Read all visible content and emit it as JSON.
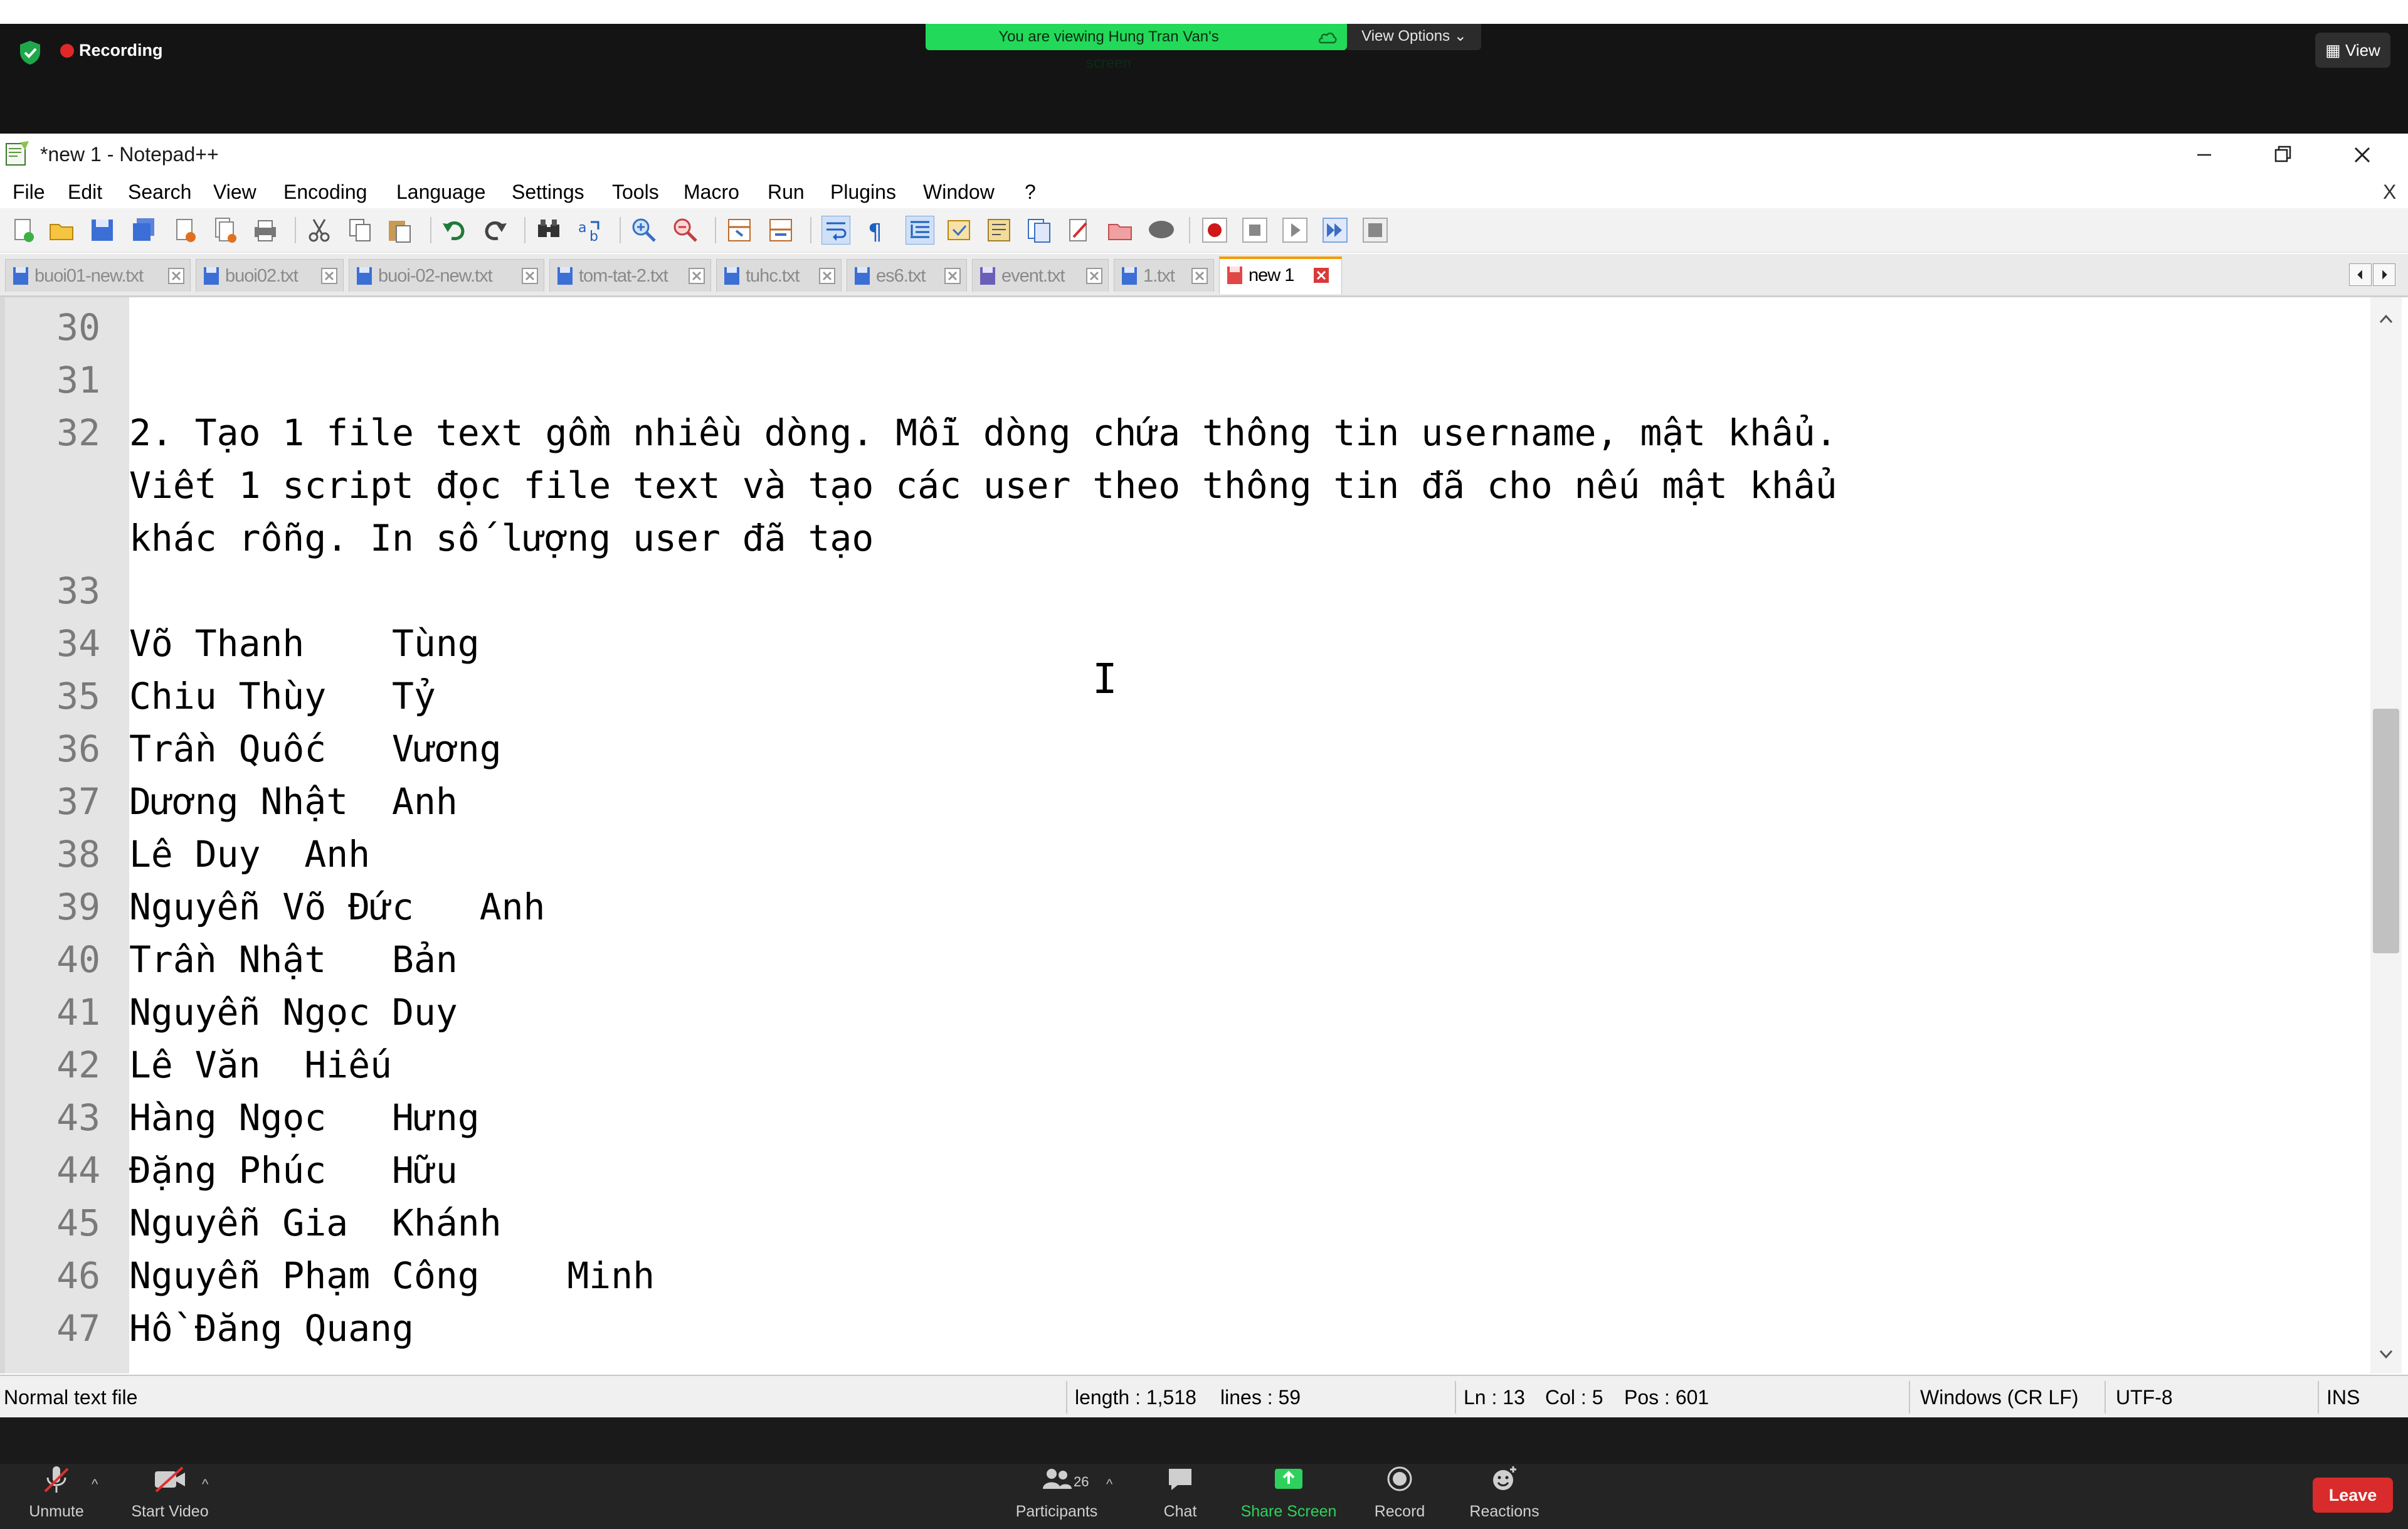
{
  "zoom": {
    "recording_label": "Recording",
    "viewing_banner": "You are viewing Hung Tran Van's screen",
    "view_options_label": "View Options ⌄",
    "view_button_label": "View",
    "bottom": {
      "unmute": "Unmute",
      "start_video": "Start Video",
      "participants": "Participants",
      "participants_count": "26",
      "chat": "Chat",
      "share_screen": "Share Screen",
      "record": "Record",
      "reactions": "Reactions",
      "leave": "Leave"
    },
    "colors": {
      "share_green": "#2ed15c",
      "leave_red": "#d92b2b",
      "banner_green": "#23d959"
    }
  },
  "notepad": {
    "title": "*new 1 - Notepad++",
    "menu": [
      "File",
      "Edit",
      "Search",
      "View",
      "Encoding",
      "Language",
      "Settings",
      "Tools",
      "Macro",
      "Run",
      "Plugins",
      "Window",
      "?"
    ],
    "menu_close": "X",
    "tabs": [
      {
        "label": "buoi01-new.txt",
        "active": false
      },
      {
        "label": "buoi02.txt",
        "active": false
      },
      {
        "label": "buoi-02-new.txt",
        "active": false
      },
      {
        "label": "tom-tat-2.txt",
        "active": false
      },
      {
        "label": "tuhc.txt",
        "active": false
      },
      {
        "label": "es6.txt",
        "active": false
      },
      {
        "label": "event.txt",
        "active": false
      },
      {
        "label": "1.txt",
        "active": false
      },
      {
        "label": "new 1",
        "active": true
      }
    ],
    "editor": {
      "lines": [
        {
          "n": "30",
          "text": ""
        },
        {
          "n": "31",
          "text": ""
        },
        {
          "n": "32",
          "text": "2. Tạo 1 file text gồm nhiều dòng. Mỗi dòng chứa thông tin username, mật khẩu."
        },
        {
          "n": "",
          "text": "Viết 1 script đọc file text và tạo các user theo thông tin đã cho nếu mật khẩu"
        },
        {
          "n": "",
          "text": "khác rỗng. In số lượng user đã tạo"
        },
        {
          "n": "33",
          "text": ""
        },
        {
          "n": "34",
          "text": "Võ Thanh    Tùng"
        },
        {
          "n": "35",
          "text": "Chiu Thùy   Tỷ"
        },
        {
          "n": "36",
          "text": "Trần Quốc   Vương"
        },
        {
          "n": "37",
          "text": "Dương Nhật  Anh"
        },
        {
          "n": "38",
          "text": "Lê Duy  Anh"
        },
        {
          "n": "39",
          "text": "Nguyễn Võ Đức   Anh"
        },
        {
          "n": "40",
          "text": "Trần Nhật   Bản"
        },
        {
          "n": "41",
          "text": "Nguyễn Ngọc Duy"
        },
        {
          "n": "42",
          "text": "Lê Văn  Hiếu"
        },
        {
          "n": "43",
          "text": "Hàng Ngọc   Hưng"
        },
        {
          "n": "44",
          "text": "Đặng Phúc   Hữu"
        },
        {
          "n": "45",
          "text": "Nguyễn Gia  Khánh"
        },
        {
          "n": "46",
          "text": "Nguyễn Phạm Công    Minh"
        },
        {
          "n": "47",
          "text": "Hồ Đăng Quang"
        }
      ]
    },
    "status": {
      "file_type": "Normal text file",
      "length": "length : 1,518",
      "lines": "lines : 59",
      "ln": "Ln : 13",
      "col": "Col : 5",
      "pos": "Pos : 601",
      "eol": "Windows (CR LF)",
      "encoding": "UTF-8",
      "mode": "INS"
    },
    "icons": {
      "toolbar": [
        "new-file-icon",
        "open-file-icon",
        "save-icon",
        "save-all-icon",
        "close-icon",
        "close-all-icon",
        "print-icon",
        "cut-icon",
        "copy-icon",
        "paste-icon",
        "undo-icon",
        "redo-icon",
        "find-icon",
        "replace-icon",
        "zoom-in-icon",
        "zoom-out-icon",
        "sync-vertical-icon",
        "sync-horizontal-icon",
        "word-wrap-icon",
        "show-all-chars-icon",
        "indent-guide-icon",
        "udl-icon",
        "document-map-icon",
        "function-list-icon",
        "folder-workspace-icon",
        "monitoring-icon",
        "record-macro-icon",
        "stop-macro-icon",
        "play-macro-icon",
        "run-macro-multiple-icon",
        "save-macro-icon"
      ]
    }
  }
}
